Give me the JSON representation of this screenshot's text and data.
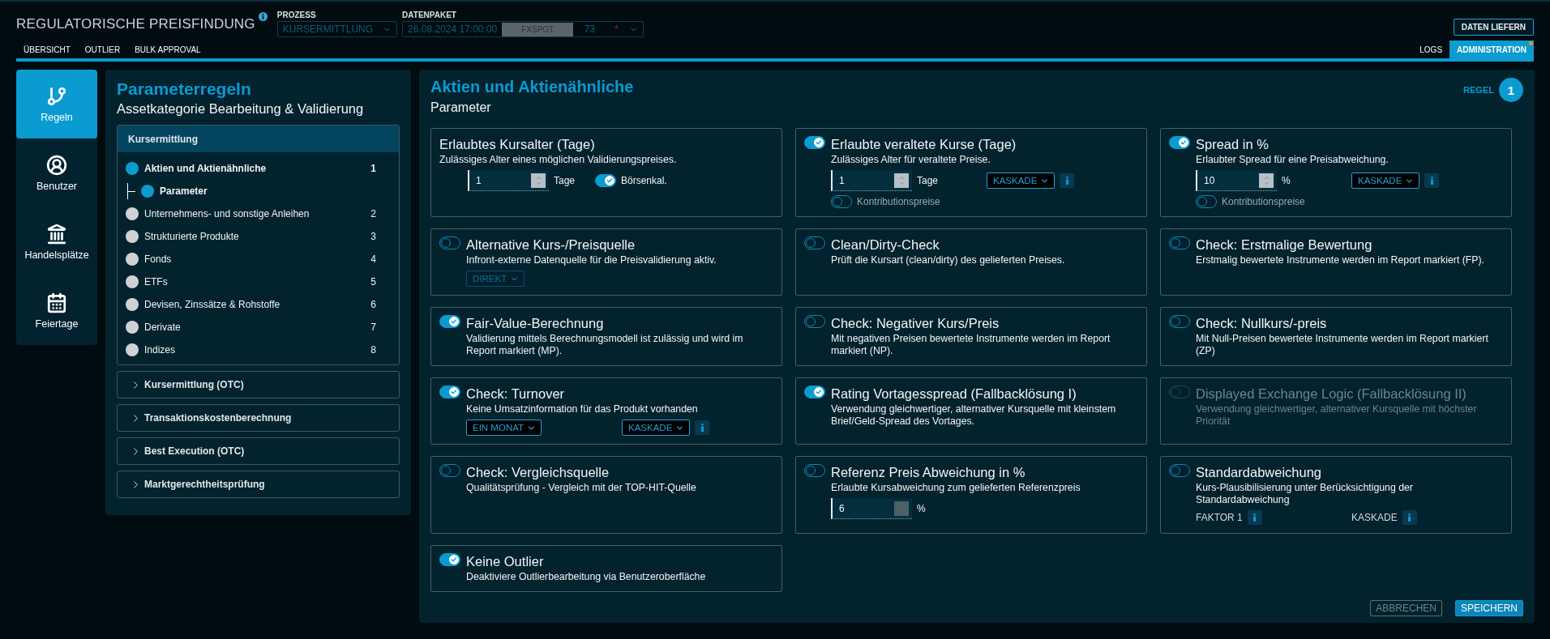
{
  "header": {
    "title": "REGULATORISCHE PREISFINDUNG",
    "process": {
      "label": "PROZESS",
      "value": "KURSERMITTLUNG"
    },
    "data_package": {
      "label": "DATENPAKET",
      "date": "26.08.2024 17:00:00",
      "source": "FXSPOT",
      "count": "73",
      "marker": "*"
    },
    "action": "DATEN LIEFERN"
  },
  "tabs_left": [
    {
      "label": "ÜBERSICHT",
      "selected": false,
      "alert": false
    },
    {
      "label": "OUTLIER",
      "selected": false,
      "alert": false
    },
    {
      "label": "BULK APPROVAL",
      "selected": false,
      "alert": false
    }
  ],
  "tabs_right": [
    {
      "label": "LOGS",
      "selected": false,
      "alert": false
    },
    {
      "label": "ADMINISTRATION",
      "selected": true,
      "alert": true
    }
  ],
  "nav_items": [
    {
      "label": "Regeln",
      "selected": true
    },
    {
      "label": "Benutzer",
      "selected": false
    },
    {
      "label": "Handelsplätze",
      "selected": false
    },
    {
      "label": "Feiertage",
      "selected": false
    }
  ],
  "rules_panel": {
    "title": "Parameterregeln",
    "subtitle": "Assetkategorie Bearbeitung & Validierung",
    "sections": [
      {
        "title": "Kursermittlung",
        "expanded": true,
        "items": [
          {
            "label": "Aktien und Aktienähnliche",
            "number": "1",
            "selected": true,
            "children": [
              {
                "label": "Parameter",
                "selected": true
              }
            ]
          },
          {
            "label": "Unternehmens- und sonstige Anleihen",
            "number": "2",
            "selected": false
          },
          {
            "label": "Strukturierte Produkte",
            "number": "3",
            "selected": false
          },
          {
            "label": "Fonds",
            "number": "4",
            "selected": false
          },
          {
            "label": "ETFs",
            "number": "5",
            "selected": false
          },
          {
            "label": "Devisen, Zinssätze & Rohstoffe",
            "number": "6",
            "selected": false
          },
          {
            "label": "Derivate",
            "number": "7",
            "selected": false
          },
          {
            "label": "Indizes",
            "number": "8",
            "selected": false
          }
        ]
      },
      {
        "title": "Kursermittlung (OTC)",
        "expanded": false
      },
      {
        "title": "Transaktionskostenberechnung",
        "expanded": false
      },
      {
        "title": "Best Execution (OTC)",
        "expanded": false
      },
      {
        "title": "Marktgerechtheitsprüfung",
        "expanded": false
      }
    ]
  },
  "main": {
    "title": "Aktien und Aktienähnliche",
    "subtitle": "Parameter",
    "rule_label": "REGEL",
    "rule_number": "1"
  },
  "cards": [
    {
      "title": "Erlaubtes Kursalter (Tage)",
      "description": "Zulässiges Alter eines möglichen Validierungspreises.",
      "rows": [
        {
          "main": [
            {
              "kind": "number",
              "value": "1",
              "unit": "Tage",
              "disabled": false
            }
          ],
          "side": [
            {
              "kind": "toggle",
              "label": "Börsenkal.",
              "on": true
            }
          ]
        }
      ]
    },
    {
      "on": true,
      "disabled": false,
      "title": "Erlaubte veraltete Kurse (Tage)",
      "description": "Zulässiges Alter für veraltete Preise.",
      "rows": [
        {
          "main": [
            {
              "kind": "number",
              "value": "1",
              "unit": "Tage",
              "disabled": false
            }
          ],
          "side": [
            {
              "kind": "select",
              "value": "KASKADE",
              "disabled": false
            },
            {
              "kind": "info"
            }
          ]
        },
        {
          "main": [
            {
              "kind": "toggle",
              "label": "Kontributionspreise",
              "on": false
            }
          ]
        }
      ]
    },
    {
      "on": true,
      "disabled": false,
      "title": "Spread in %",
      "description": "Erlaubter Spread für eine Preisabweichung.",
      "rows": [
        {
          "main": [
            {
              "kind": "number",
              "value": "10",
              "unit": "%",
              "disabled": false
            }
          ],
          "side": [
            {
              "kind": "select",
              "value": "KASKADE",
              "disabled": false
            },
            {
              "kind": "info"
            }
          ]
        },
        {
          "main": [
            {
              "kind": "toggle",
              "label": "Kontributionspreise",
              "on": false
            }
          ]
        }
      ]
    },
    {
      "on": false,
      "disabled": false,
      "title": "Alternative Kurs-/Preisquelle",
      "description": "Infront-externe Datenquelle für die Preisvalidierung aktiv.",
      "rows": [
        {
          "main": [
            {
              "kind": "select",
              "value": "DIREKT",
              "disabled": true
            }
          ]
        }
      ]
    },
    {
      "on": false,
      "disabled": false,
      "title": "Clean/Dirty-Check",
      "description": "Prüft die Kursart (clean/dirty) des gelieferten Preises."
    },
    {
      "on": false,
      "disabled": false,
      "title": "Check: Erstmalige Bewertung",
      "description": "Erstmalig bewertete Instrumente werden im Report markiert (FP)."
    },
    {
      "on": true,
      "disabled": false,
      "title": "Fair-Value-Berechnung",
      "description": "Validierung mittels Berechnungsmodell ist zulässig und wird im Report markiert (MP)."
    },
    {
      "on": false,
      "disabled": false,
      "title": "Check: Negativer Kurs/Preis",
      "description": "Mit negativen Preisen bewertete Instrumente werden im Report markiert (NP)."
    },
    {
      "on": false,
      "disabled": false,
      "title": "Check: Nullkurs/-preis",
      "description": "Mit Null-Preisen bewertete Instrumente werden im Report markiert (ZP)"
    },
    {
      "on": true,
      "disabled": false,
      "title": "Check: Turnover",
      "description": "Keine Umsatzinformation für das Produkt vorhanden",
      "rows": [
        {
          "main": [
            {
              "kind": "select",
              "value": "EIN MONAT",
              "disabled": false
            }
          ],
          "side": [
            {
              "kind": "select",
              "value": "KASKADE",
              "disabled": false
            },
            {
              "kind": "info"
            }
          ]
        }
      ]
    },
    {
      "on": true,
      "disabled": false,
      "title": "Rating Vortagesspread (Fallbacklösung I)",
      "description": "Verwendung gleichwertiger, alternativer Kursquelle mit kleinstem Brief/Geld-Spread des Vortages."
    },
    {
      "on": false,
      "disabled": true,
      "title": "Displayed Exchange Logic (Fallbacklösung II)",
      "description": "Verwendung gleichwertiger, alternativer Kursquelle mit höchster Priorität"
    },
    {
      "on": false,
      "disabled": false,
      "title": "Check: Vergleichsquelle",
      "description": "Qualitätsprüfung - Vergleich mit der TOP-HIT-Quelle"
    },
    {
      "on": false,
      "disabled": false,
      "title": "Referenz Preis Abweichung in %",
      "description": "Erlaubte Kursabweichung zum gelieferten Referenzpreis",
      "rows": [
        {
          "main": [
            {
              "kind": "number",
              "value": "6",
              "unit": "%",
              "disabled": true
            }
          ]
        }
      ]
    },
    {
      "on": false,
      "disabled": false,
      "title": "Standardabweichung",
      "description": "Kurs-Plausibilisierung unter Berücksichtigung der Standardabweichung",
      "rows": [
        {
          "main": [
            {
              "kind": "label",
              "label": "FAKTOR 1"
            },
            {
              "kind": "info"
            }
          ],
          "side": [
            {
              "kind": "label",
              "label": "KASKADE"
            },
            {
              "kind": "info"
            }
          ]
        }
      ]
    },
    {
      "on": true,
      "disabled": false,
      "title": "Keine Outlier",
      "description": "Deaktiviere Outlierbearbeitung via Benutzeroberfläche"
    }
  ],
  "footer": [
    {
      "label": "ABBRECHEN",
      "disabled": true
    },
    {
      "label": "SPEICHERN",
      "disabled": false
    }
  ]
}
